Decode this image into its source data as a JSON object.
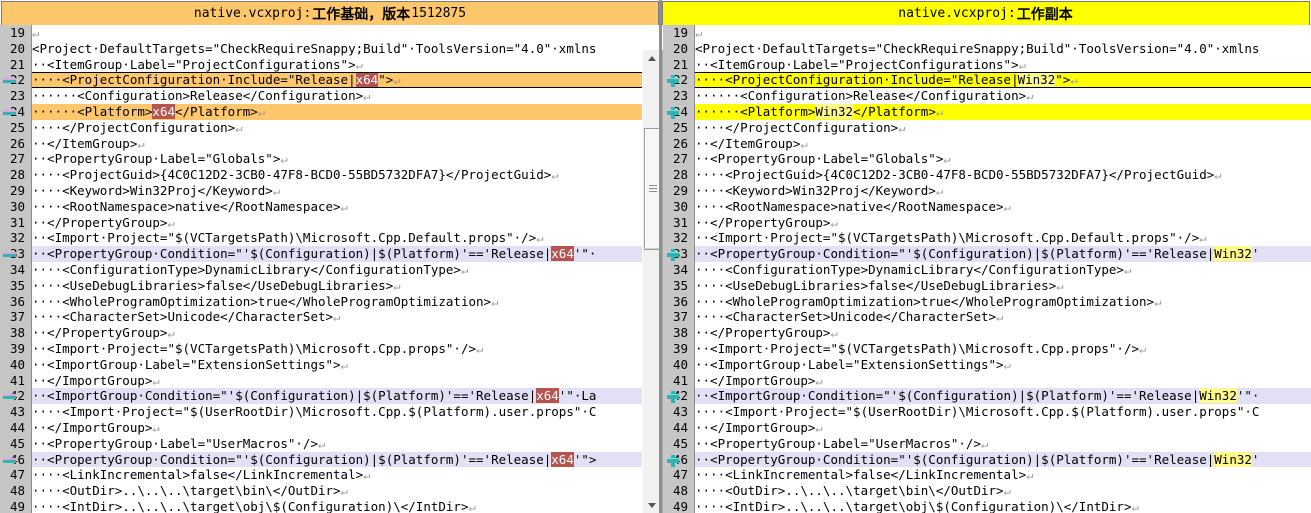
{
  "panes": {
    "left": {
      "header": {
        "file": "native.vcxproj",
        "sep": " : ",
        "label": "工作基础，版本",
        "version": "1512875",
        "bg": "#ffc76b"
      },
      "platform_token": "x64",
      "diff_marker": "minus-icon",
      "lines": [
        {
          "n": "19",
          "text": "",
          "pilcrow": true,
          "state": "normal"
        },
        {
          "n": "20",
          "text": "<Project·DefaultTargets=\"CheckRequireSnappy;Build\"·ToolsVersion=\"4.0\"·xmlns",
          "pilcrow": false,
          "state": "normal"
        },
        {
          "n": "21",
          "text": "··<ItemGroup·Label=\"ProjectConfigurations\">",
          "pilcrow": true,
          "state": "normal"
        },
        {
          "n": "22",
          "pre": "····<ProjectConfiguration·Include=\"Release|",
          "token": "x64",
          "post": "\">",
          "pilcrow": true,
          "state": "changed-box",
          "band": "orange",
          "marker": true
        },
        {
          "n": "23",
          "text": "······<Configuration>Release</Configuration>",
          "pilcrow": true,
          "state": "normal"
        },
        {
          "n": "24",
          "pre": "······<Platform>",
          "token": "x64",
          "post": "</Platform>",
          "pilcrow": true,
          "state": "changed",
          "band": "orange",
          "marker": true
        },
        {
          "n": "25",
          "text": "····</ProjectConfiguration>",
          "pilcrow": true,
          "state": "normal"
        },
        {
          "n": "26",
          "text": "··</ItemGroup>",
          "pilcrow": true,
          "state": "normal"
        },
        {
          "n": "27",
          "text": "··<PropertyGroup·Label=\"Globals\">",
          "pilcrow": true,
          "state": "normal"
        },
        {
          "n": "28",
          "text": "····<ProjectGuid>{4C0C12D2-3CB0-47F8-BCD0-55BD5732DFA7}</ProjectGuid>",
          "pilcrow": true,
          "state": "normal"
        },
        {
          "n": "29",
          "text": "····<Keyword>Win32Proj</Keyword>",
          "pilcrow": true,
          "state": "normal"
        },
        {
          "n": "30",
          "text": "····<RootNamespace>native</RootNamespace>",
          "pilcrow": true,
          "state": "normal"
        },
        {
          "n": "31",
          "text": "··</PropertyGroup>",
          "pilcrow": true,
          "state": "normal"
        },
        {
          "n": "32",
          "text": "··<Import·Project=\"$(VCTargetsPath)\\Microsoft.Cpp.Default.props\"·/>",
          "pilcrow": true,
          "state": "normal"
        },
        {
          "n": "33",
          "pre": "··<PropertyGroup·Condition=\"'$(Configuration)|$(Platform)'=='Release|",
          "token": "x64",
          "post": "'\"·",
          "pilcrow": false,
          "state": "changed",
          "band": "lav",
          "marker": true
        },
        {
          "n": "34",
          "text": "····<ConfigurationType>DynamicLibrary</ConfigurationType>",
          "pilcrow": true,
          "state": "normal"
        },
        {
          "n": "35",
          "text": "····<UseDebugLibraries>false</UseDebugLibraries>",
          "pilcrow": true,
          "state": "normal"
        },
        {
          "n": "36",
          "text": "····<WholeProgramOptimization>true</WholeProgramOptimization>",
          "pilcrow": true,
          "state": "normal"
        },
        {
          "n": "37",
          "text": "····<CharacterSet>Unicode</CharacterSet>",
          "pilcrow": true,
          "state": "normal"
        },
        {
          "n": "38",
          "text": "··</PropertyGroup>",
          "pilcrow": true,
          "state": "normal"
        },
        {
          "n": "39",
          "text": "··<Import·Project=\"$(VCTargetsPath)\\Microsoft.Cpp.props\"·/>",
          "pilcrow": true,
          "state": "normal"
        },
        {
          "n": "40",
          "text": "··<ImportGroup·Label=\"ExtensionSettings\">",
          "pilcrow": true,
          "state": "normal"
        },
        {
          "n": "41",
          "text": "··</ImportGroup>",
          "pilcrow": true,
          "state": "normal"
        },
        {
          "n": "42",
          "pre": "··<ImportGroup·Condition=\"'$(Configuration)|$(Platform)'=='Release|",
          "token": "x64",
          "post": "'\"·La",
          "pilcrow": false,
          "state": "changed",
          "band": "lav",
          "marker": true
        },
        {
          "n": "43",
          "text": "····<Import·Project=\"$(UserRootDir)\\Microsoft.Cpp.$(Platform).user.props\"·C",
          "pilcrow": false,
          "state": "normal"
        },
        {
          "n": "44",
          "text": "··</ImportGroup>",
          "pilcrow": true,
          "state": "normal"
        },
        {
          "n": "45",
          "text": "··<PropertyGroup·Label=\"UserMacros\"·/>",
          "pilcrow": true,
          "state": "normal"
        },
        {
          "n": "46",
          "pre": "··<PropertyGroup·Condition=\"'$(Configuration)|$(Platform)'=='Release|",
          "token": "x64",
          "post": "'\">",
          "pilcrow": false,
          "state": "changed",
          "band": "lav",
          "marker": true
        },
        {
          "n": "47",
          "text": "····<LinkIncremental>false</LinkIncremental>",
          "pilcrow": true,
          "state": "normal"
        },
        {
          "n": "48",
          "text": "····<OutDir>..\\..\\..\\target\\bin\\</OutDir>",
          "pilcrow": true,
          "state": "normal"
        },
        {
          "n": "49",
          "text": "····<IntDir>..\\..\\..\\target\\obj\\$(Configuration)\\</IntDir>",
          "pilcrow": true,
          "state": "normal"
        }
      ]
    },
    "right": {
      "header": {
        "file": "native.vcxproj",
        "sep": " : ",
        "label": "工作副本",
        "version": "",
        "bg": "#ffff00"
      },
      "platform_token": "Win32",
      "diff_marker": "plus-icon",
      "lines": [
        {
          "n": "19",
          "text": "",
          "pilcrow": true,
          "state": "normal"
        },
        {
          "n": "20",
          "text": "<Project·DefaultTargets=\"CheckRequireSnappy;Build\"·ToolsVersion=\"4.0\"·xmlns",
          "pilcrow": false,
          "state": "normal"
        },
        {
          "n": "21",
          "text": "··<ItemGroup·Label=\"ProjectConfigurations\">",
          "pilcrow": true,
          "state": "normal"
        },
        {
          "n": "22",
          "pre": "····<ProjectConfiguration·Include=\"Release|",
          "token": "Win32",
          "post": "\">",
          "pilcrow": true,
          "state": "changed-box",
          "band": "yellow",
          "marker": true,
          "caret": true
        },
        {
          "n": "23",
          "text": "······<Configuration>Release</Configuration>",
          "pilcrow": true,
          "state": "normal"
        },
        {
          "n": "24",
          "pre": "······<Platform>",
          "token": "Win32",
          "post": "</Platform>",
          "pilcrow": true,
          "state": "changed",
          "band": "yellow",
          "marker": true
        },
        {
          "n": "25",
          "text": "····</ProjectConfiguration>",
          "pilcrow": true,
          "state": "normal"
        },
        {
          "n": "26",
          "text": "··</ItemGroup>",
          "pilcrow": true,
          "state": "normal"
        },
        {
          "n": "27",
          "text": "··<PropertyGroup·Label=\"Globals\">",
          "pilcrow": true,
          "state": "normal"
        },
        {
          "n": "28",
          "text": "····<ProjectGuid>{4C0C12D2-3CB0-47F8-BCD0-55BD5732DFA7}</ProjectGuid>",
          "pilcrow": true,
          "state": "normal"
        },
        {
          "n": "29",
          "text": "····<Keyword>Win32Proj</Keyword>",
          "pilcrow": true,
          "state": "normal"
        },
        {
          "n": "30",
          "text": "····<RootNamespace>native</RootNamespace>",
          "pilcrow": true,
          "state": "normal"
        },
        {
          "n": "31",
          "text": "··</PropertyGroup>",
          "pilcrow": true,
          "state": "normal"
        },
        {
          "n": "32",
          "text": "··<Import·Project=\"$(VCTargetsPath)\\Microsoft.Cpp.Default.props\"·/>",
          "pilcrow": true,
          "state": "normal"
        },
        {
          "n": "33",
          "pre": "··<PropertyGroup·Condition=\"'$(Configuration)|$(Platform)'=='Release|",
          "token": "Win32",
          "post": "'",
          "pilcrow": false,
          "state": "changed",
          "band": "lav",
          "marker": true
        },
        {
          "n": "34",
          "text": "····<ConfigurationType>DynamicLibrary</ConfigurationType>",
          "pilcrow": true,
          "state": "normal"
        },
        {
          "n": "35",
          "text": "····<UseDebugLibraries>false</UseDebugLibraries>",
          "pilcrow": true,
          "state": "normal"
        },
        {
          "n": "36",
          "text": "····<WholeProgramOptimization>true</WholeProgramOptimization>",
          "pilcrow": true,
          "state": "normal"
        },
        {
          "n": "37",
          "text": "····<CharacterSet>Unicode</CharacterSet>",
          "pilcrow": true,
          "state": "normal"
        },
        {
          "n": "38",
          "text": "··</PropertyGroup>",
          "pilcrow": true,
          "state": "normal"
        },
        {
          "n": "39",
          "text": "··<Import·Project=\"$(VCTargetsPath)\\Microsoft.Cpp.props\"·/>",
          "pilcrow": true,
          "state": "normal"
        },
        {
          "n": "40",
          "text": "··<ImportGroup·Label=\"ExtensionSettings\">",
          "pilcrow": true,
          "state": "normal"
        },
        {
          "n": "41",
          "text": "··</ImportGroup>",
          "pilcrow": true,
          "state": "normal"
        },
        {
          "n": "42",
          "pre": "··<ImportGroup·Condition=\"'$(Configuration)|$(Platform)'=='Release|",
          "token": "Win32",
          "post": "'\"·",
          "pilcrow": false,
          "state": "changed",
          "band": "lav",
          "marker": true
        },
        {
          "n": "43",
          "text": "····<Import·Project=\"$(UserRootDir)\\Microsoft.Cpp.$(Platform).user.props\"·C",
          "pilcrow": false,
          "state": "normal"
        },
        {
          "n": "44",
          "text": "··</ImportGroup>",
          "pilcrow": true,
          "state": "normal"
        },
        {
          "n": "45",
          "text": "··<PropertyGroup·Label=\"UserMacros\"·/>",
          "pilcrow": true,
          "state": "normal"
        },
        {
          "n": "46",
          "pre": "··<PropertyGroup·Condition=\"'$(Configuration)|$(Platform)'=='Release|",
          "token": "Win32",
          "post": "'",
          "pilcrow": false,
          "state": "changed",
          "band": "lav",
          "marker": true
        },
        {
          "n": "47",
          "text": "····<LinkIncremental>false</LinkIncremental>",
          "pilcrow": true,
          "state": "normal"
        },
        {
          "n": "48",
          "text": "····<OutDir>..\\..\\..\\target\\bin\\</OutDir>",
          "pilcrow": true,
          "state": "normal"
        },
        {
          "n": "49",
          "text": "····<IntDir>..\\..\\..\\target\\obj\\$(Configuration)\\</IntDir>",
          "pilcrow": true,
          "state": "normal"
        }
      ]
    }
  },
  "scrollbar": {
    "up_arrow": "arrow-up-icon",
    "down_arrow": "arrow-down-icon",
    "grip": "scroll-grip-icon"
  },
  "colors": {
    "base_header_bg": "#ffc76b",
    "copy_header_bg": "#ffff00",
    "deleted_token_bg": "#b85450",
    "inserted_token_bg": "#fffb8a",
    "changed_line_bg": "#e2e0f5",
    "gutter_bg": "#c6c6c6",
    "marker_teal": "#2fb3b3"
  }
}
